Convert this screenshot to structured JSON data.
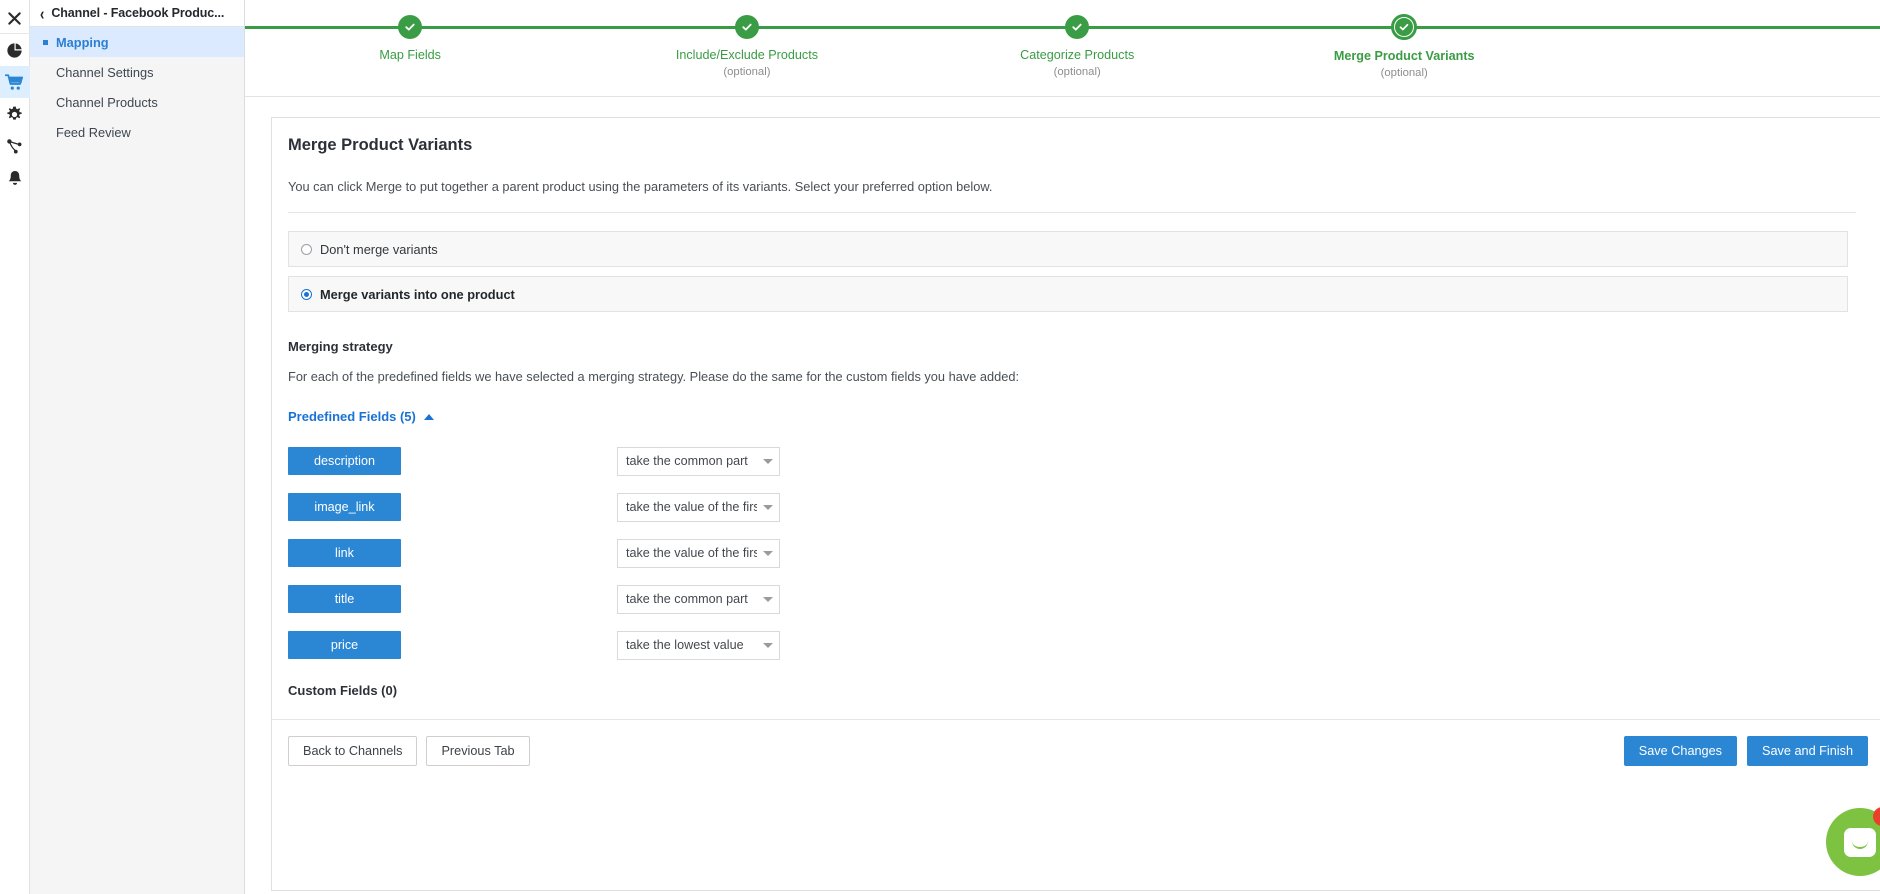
{
  "icon_rail": {
    "items": [
      {
        "name": "close-icon",
        "glyph": "close"
      },
      {
        "name": "pie-chart-icon",
        "glyph": "pie"
      },
      {
        "name": "shopping-cart-icon",
        "glyph": "cart",
        "active": true
      },
      {
        "name": "gear-icon",
        "glyph": "gear"
      },
      {
        "name": "share-nodes-icon",
        "glyph": "share"
      },
      {
        "name": "bell-icon",
        "glyph": "bell"
      }
    ]
  },
  "sidebar": {
    "back_label": "‹",
    "title": "Channel - Facebook Produc...",
    "items": [
      {
        "label": "Mapping",
        "active": true
      },
      {
        "label": "Channel Settings",
        "active": false
      },
      {
        "label": "Channel Products",
        "active": false
      },
      {
        "label": "Feed Review",
        "active": false
      }
    ]
  },
  "stepper": {
    "accent_color": "#3a9c44",
    "steps": [
      {
        "label": "Map Fields",
        "optional": "",
        "state": "complete",
        "x_pct": 10.1
      },
      {
        "label": "Include/Exclude Products",
        "optional": "(optional)",
        "state": "complete",
        "x_pct": 30.7
      },
      {
        "label": "Categorize Products",
        "optional": "(optional)",
        "state": "complete",
        "x_pct": 50.9
      },
      {
        "label": "Merge Product Variants",
        "optional": "(optional)",
        "state": "current",
        "x_pct": 70.9
      }
    ]
  },
  "card": {
    "title": "Merge Product Variants",
    "description": "You can click Merge to put together a parent product using the parameters of its variants. Select your preferred option below.",
    "options": [
      {
        "label": "Don't merge variants",
        "selected": false
      },
      {
        "label": "Merge variants into one product",
        "selected": true
      }
    ],
    "merging_strategy": {
      "title": "Merging strategy",
      "description": "For each of the predefined fields we have selected a merging strategy. Please do the same for the custom fields you have added:",
      "predefined_header": "Predefined Fields (5)",
      "fields": [
        {
          "field": "description",
          "strategy": "take the common part"
        },
        {
          "field": "image_link",
          "strategy": "take the value of the first v"
        },
        {
          "field": "link",
          "strategy": "take the value of the first v"
        },
        {
          "field": "title",
          "strategy": "take the common part"
        },
        {
          "field": "price",
          "strategy": "take the lowest value"
        }
      ],
      "custom_fields_header": "Custom Fields (0)"
    },
    "footer": {
      "back_to_channels": "Back to Channels",
      "previous_tab": "Previous Tab",
      "save_changes": "Save Changes",
      "save_and_finish": "Save and Finish"
    }
  },
  "chat_widget": {
    "name": "chat-launcher",
    "color": "#7ec242",
    "badge_color": "#e8402a"
  }
}
